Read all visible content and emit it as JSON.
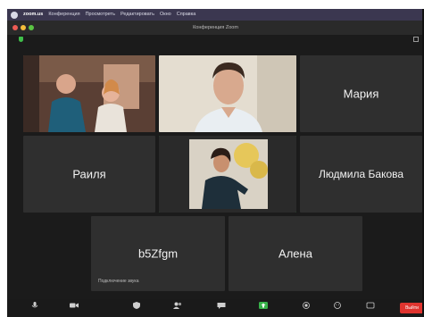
{
  "menubar": {
    "app_name": "zoom.us",
    "items": [
      "Конференция",
      "Просмотреть",
      "Редактировать",
      "Окно",
      "Справка"
    ]
  },
  "window": {
    "title": "Конференция Zoom"
  },
  "participants": [
    {
      "name": "",
      "has_video": true
    },
    {
      "name": "",
      "has_video": true
    },
    {
      "name": "Мария",
      "has_video": false
    },
    {
      "name": "Раиля",
      "has_video": false
    },
    {
      "name": "",
      "has_video": true,
      "active_speaker": true
    },
    {
      "name": "Людмила Бакова",
      "has_video": false
    },
    {
      "name": "b5Zfgm",
      "has_video": false
    },
    {
      "name": "Алена",
      "has_video": false
    }
  ],
  "self_caption": "Подключение звука",
  "toolbar": {
    "end_label": "Выйти"
  },
  "colors": {
    "speaker_border": "#33b844",
    "end_button": "#e0342f",
    "tile_bg": "#2f2f2f",
    "app_bg": "#1b1b1b"
  }
}
